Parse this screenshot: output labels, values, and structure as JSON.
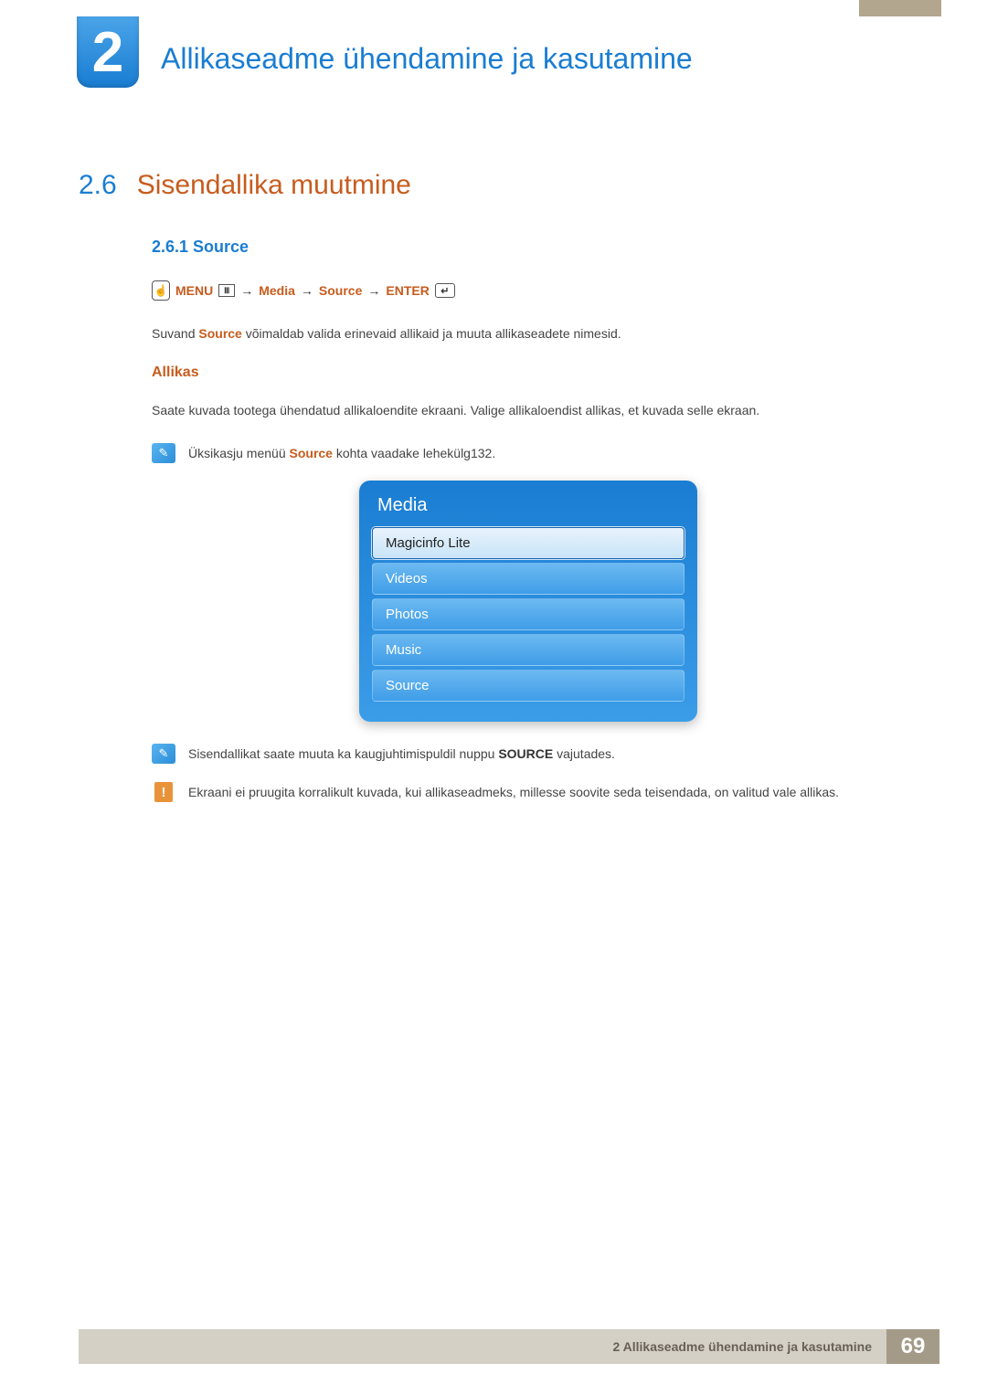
{
  "chapter": {
    "number": "2",
    "title": "Allikaseadme ühendamine ja kasutamine"
  },
  "section": {
    "number": "2.6",
    "title": "Sisendallika muutmine"
  },
  "subsection": {
    "heading": "2.6.1  Source"
  },
  "breadcrumb": {
    "menu": "MENU",
    "arrow1": "→",
    "media": "Media",
    "arrow2": "→",
    "source": "Source",
    "arrow3": "→",
    "enter": "ENTER"
  },
  "paragraphs": {
    "p1_pre": "Suvand ",
    "p1_bold": "Source",
    "p1_post": " võimaldab valida erinevaid allikaid ja muuta allikaseadete nimesid.",
    "allikas_heading": "Allikas",
    "p2": "Saate kuvada tootega ühendatud allikaloendite ekraani. Valige allikaloendist allikas, et kuvada selle ekraan."
  },
  "notes": {
    "n1_pre": "Üksikasju menüü ",
    "n1_bold": "Source",
    "n1_post": " kohta vaadake lehekülg132.",
    "n2_pre": "Sisendallikat saate muuta ka kaugjuhtimispuldil nuppu ",
    "n2_bold": "SOURCE",
    "n2_post": " vajutades.",
    "n3": "Ekraani ei pruugita korralikult kuvada, kui allikaseadmeks, millesse soovite seda teisendada, on valitud vale allikas."
  },
  "media_panel": {
    "title": "Media",
    "items": [
      "Magicinfo Lite",
      "Videos",
      "Photos",
      "Music",
      "Source"
    ]
  },
  "footer": {
    "text": "2 Allikaseadme ühendamine ja kasutamine",
    "page": "69"
  }
}
